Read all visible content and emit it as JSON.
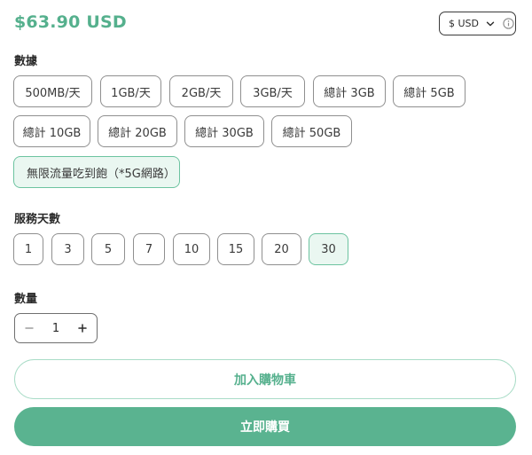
{
  "price": "$63.90 USD",
  "currency_selector": {
    "label": "$ USD",
    "chevron_icon": "chevron-down-icon",
    "info_icon": "info-icon"
  },
  "data_section": {
    "title": "數據",
    "options": [
      "500MB/天",
      "1GB/天",
      "2GB/天",
      "3GB/天",
      "總計 3GB",
      "總計 5GB",
      "總計 10GB",
      "總計 20GB",
      "總計 30GB",
      "總計 50GB",
      "無限流量吃到飽（*5G網路）"
    ],
    "selected": "無限流量吃到飽（*5G網路）"
  },
  "days_section": {
    "title": "服務天數",
    "options": [
      "1",
      "3",
      "5",
      "7",
      "10",
      "15",
      "20",
      "30"
    ],
    "selected": "30"
  },
  "quantity_section": {
    "title": "數量",
    "value": "1",
    "minus_icon": "minus-icon",
    "plus_icon": "plus-icon"
  },
  "actions": {
    "add_to_cart": "加入購物車",
    "buy_now": "立即購買"
  },
  "colors": {
    "accent": "#55b08d",
    "selected_bg": "#eaf7f1",
    "buy_bg": "#5ab390"
  }
}
